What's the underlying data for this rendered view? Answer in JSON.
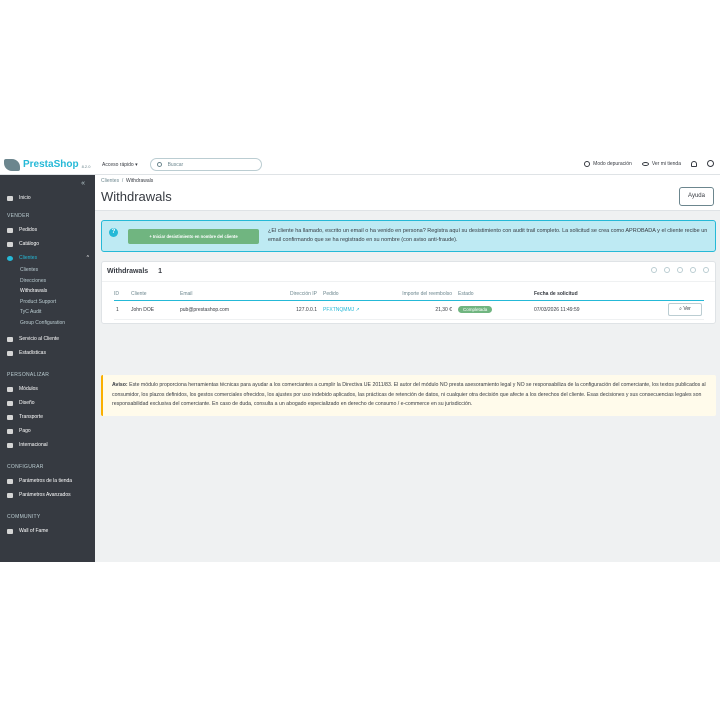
{
  "header": {
    "brand": "PrestaShop",
    "version": "8.2.0",
    "quick_access": "Acceso rápido ▾",
    "search_placeholder": "Buscar",
    "debug_mode": "Modo depuración",
    "view_store": "Ver mi tienda"
  },
  "sidebar": {
    "collapse": "«",
    "home": "Inicio",
    "sell_section": "VENDER",
    "sell": [
      "Pedidos",
      "Catálogo",
      "Clientes"
    ],
    "customers_sub": [
      "Clientes",
      "Direcciones",
      "Withdrawals",
      "Product Support",
      "TyC Audit",
      "Group Configuration"
    ],
    "sell_more": [
      "Servicio al Cliente",
      "Estadísticas"
    ],
    "customize_section": "PERSONALIZAR",
    "customize": [
      "Módulos",
      "Diseño",
      "Transporte",
      "Pago",
      "Internacional"
    ],
    "configure_section": "CONFIGURAR",
    "configure": [
      "Parámetros de la tienda",
      "Parámetros Avanzados"
    ],
    "community_section": "COMMUNITY",
    "community": [
      "Wall of Fame"
    ]
  },
  "page": {
    "breadcrumb_parent": "Clientes",
    "breadcrumb_sep": "/",
    "breadcrumb_current": "Withdrawals",
    "title": "Withdrawals",
    "help_button": "Ayuda"
  },
  "info": {
    "button": "+ Iniciar desistimiento en nombre del cliente",
    "text": "¿El cliente ha llamado, escrito un email o ha venido en persona? Registra aquí su desistimiento con audit trail completo. La solicitud se crea como APROBADA y el cliente recibe un email confirmando que se ha registrado en su nombre (con aviso anti-fraude)."
  },
  "panel": {
    "title": "Withdrawals",
    "count": "1",
    "columns": [
      "ID",
      "Cliente",
      "Email",
      "Dirección IP",
      "Pedido",
      "Importe del reembolso",
      "Estado",
      "Fecha de solicitud",
      ""
    ],
    "rows": [
      {
        "id": "1",
        "customer": "John DOE",
        "email": "pub@prestashop.com",
        "ip": "127.0.0.1",
        "order": "PFXTNQMMJ",
        "amount": "21,30 €",
        "status": "Completada",
        "date": "07/03/2026 11:49:59",
        "action": "Ver"
      }
    ]
  },
  "warning": {
    "label": "Aviso:",
    "text": " Este módulo proporciona herramientas técnicas para ayudar a los comerciantes a cumplir la Directiva UE 2011/83. El autor del módulo NO presta asesoramiento legal y NO se responsabiliza de la configuración del comerciante, los textos publicados al consumidor, los plazos definidos, los gestos comerciales ofrecidos, los ajustes por uso indebido aplicados, las prácticas de retención de datos, ni cualquier otra decisión que afecte a los derechos del cliente. Esas decisiones y sus consecuencias legales son responsabilidad exclusiva del comerciante. En caso de duda, consulta a un abogado especializado en derecho de consumo / e-commerce en su jurisdicción."
  },
  "colors": {
    "accent": "#25b9d7",
    "success": "#70b580",
    "sidebar": "#363a41",
    "warning": "#fab000"
  }
}
